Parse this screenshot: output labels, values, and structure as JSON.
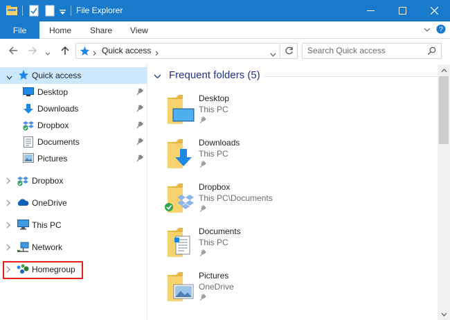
{
  "window": {
    "title": "File Explorer"
  },
  "ribbon": {
    "tabs": [
      {
        "label": "File"
      },
      {
        "label": "Home"
      },
      {
        "label": "Share"
      },
      {
        "label": "View"
      }
    ]
  },
  "address": {
    "breadcrumb": "Quick access",
    "search_placeholder": "Search Quick access"
  },
  "nav": {
    "quick_access": {
      "label": "Quick access",
      "items": [
        {
          "label": "Desktop",
          "icon": "desktop-icon"
        },
        {
          "label": "Downloads",
          "icon": "downloads-icon"
        },
        {
          "label": "Dropbox",
          "icon": "dropbox-icon"
        },
        {
          "label": "Documents",
          "icon": "documents-icon"
        },
        {
          "label": "Pictures",
          "icon": "pictures-icon"
        }
      ]
    },
    "roots": [
      {
        "label": "Dropbox",
        "icon": "dropbox-icon"
      },
      {
        "label": "OneDrive",
        "icon": "onedrive-icon"
      },
      {
        "label": "This PC",
        "icon": "this-pc-icon"
      },
      {
        "label": "Network",
        "icon": "network-icon"
      },
      {
        "label": "Homegroup",
        "icon": "homegroup-icon"
      }
    ]
  },
  "content": {
    "group_title": "Frequent folders (5)",
    "folders": [
      {
        "name": "Desktop",
        "location": "This PC",
        "overlay": "desktop-icon"
      },
      {
        "name": "Downloads",
        "location": "This PC",
        "overlay": "downloads-icon"
      },
      {
        "name": "Dropbox",
        "location": "This PC\\Documents",
        "overlay": "dropbox-icon"
      },
      {
        "name": "Documents",
        "location": "This PC",
        "overlay": "documents-icon"
      },
      {
        "name": "Pictures",
        "location": "OneDrive",
        "overlay": "pictures-icon"
      }
    ]
  },
  "colors": {
    "titlebar": "#1979ca",
    "selection": "#cce8ff",
    "group_header": "#1e3287",
    "highlight_box": "#e2231a"
  }
}
